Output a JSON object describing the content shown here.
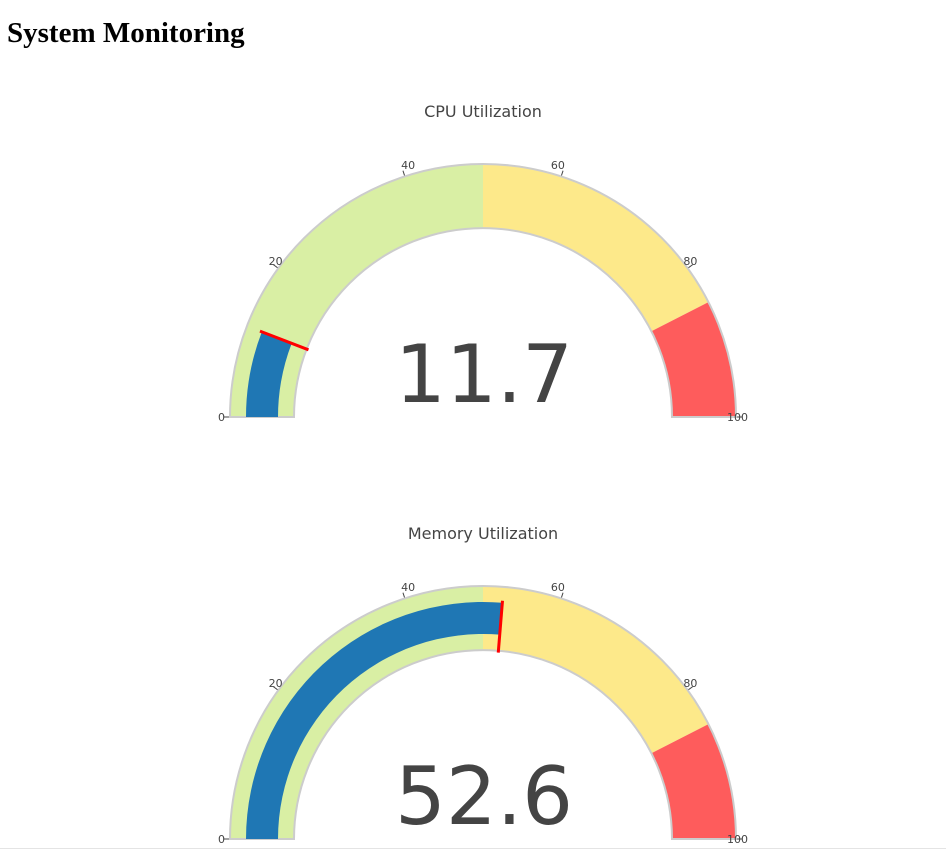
{
  "page": {
    "title": "System Monitoring"
  },
  "chart_data": [
    {
      "type": "gauge",
      "title": "CPU Utilization",
      "value": 11.7,
      "value_label": "11.7",
      "threshold": 11.7,
      "range": [
        0,
        100
      ],
      "ticks": [
        0,
        20,
        40,
        60,
        80,
        100
      ],
      "steps": [
        {
          "range": [
            0,
            50
          ],
          "color": "#d9efa4"
        },
        {
          "range": [
            50,
            85
          ],
          "color": "#fde98a"
        },
        {
          "range": [
            85,
            100
          ],
          "color": "#fe5c5c"
        }
      ],
      "bar_color": "#1f77b4",
      "threshold_color": "#ff0000",
      "border_color": "#cccccc"
    },
    {
      "type": "gauge",
      "title": "Memory Utilization",
      "value": 52.6,
      "value_label": "52.6",
      "threshold": 52.6,
      "range": [
        0,
        100
      ],
      "ticks": [
        0,
        20,
        40,
        60,
        80,
        100
      ],
      "steps": [
        {
          "range": [
            0,
            50
          ],
          "color": "#d9efa4"
        },
        {
          "range": [
            50,
            85
          ],
          "color": "#fde98a"
        },
        {
          "range": [
            85,
            100
          ],
          "color": "#fe5c5c"
        }
      ],
      "bar_color": "#1f77b4",
      "threshold_color": "#ff0000",
      "border_color": "#cccccc"
    }
  ]
}
